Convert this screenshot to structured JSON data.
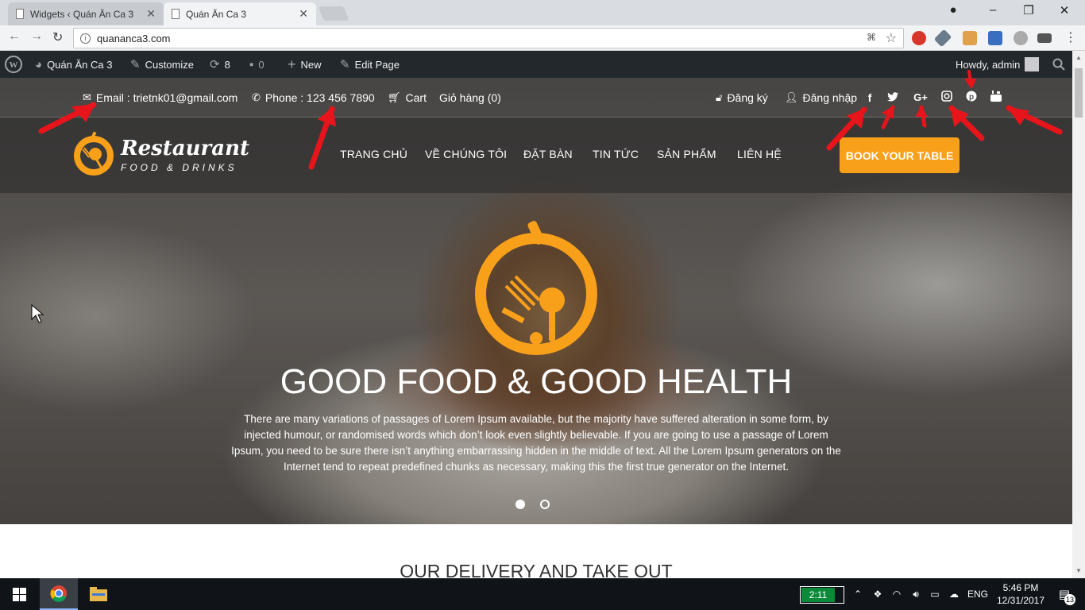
{
  "browser": {
    "tabs": [
      {
        "title": "Widgets ‹ Quán Ăn Ca 3",
        "active": false
      },
      {
        "title": "Quán Ăn Ca 3",
        "active": true
      }
    ],
    "url": "quananca3.com",
    "window_controls": {
      "minimize": "–",
      "maximize": "❐",
      "close": "✕"
    }
  },
  "admin_bar": {
    "site_name": "Quán Ăn Ca 3",
    "customize": "Customize",
    "updates_count": "8",
    "comments_count": "0",
    "new_label": "New",
    "edit_page": "Edit Page",
    "howdy": "Howdy, admin"
  },
  "top_info": {
    "email": "Email : trietnk01@gmail.com",
    "phone": "Phone : 123 456 7890",
    "cart": "Cart",
    "cart_vn": "Giỏ hàng (0)",
    "register": "Đăng ký",
    "login": "Đăng nhập",
    "social_icons": [
      "facebook-icon",
      "twitter-icon",
      "google-plus-icon",
      "instagram-icon",
      "pinterest-icon",
      "youtube-icon"
    ]
  },
  "logo": {
    "title": "Restaurant",
    "subtitle": "FOOD & DRINKS"
  },
  "menu": [
    "TRANG CHỦ",
    "VỀ CHÚNG TÔI",
    "ĐẶT BÀN",
    "TIN TỨC",
    "SẢN PHẨM",
    "LIÊN HỆ"
  ],
  "book_button": "BOOK YOUR TABLE",
  "hero": {
    "title": "GOOD FOOD & GOOD HEALTH",
    "text": "There are many variations of passages of Lorem Ipsum available, but the majority have suffered alteration in some form, by injected humour, or randomised words which don’t look even slightly believable. If you are going to use a passage of Lorem Ipsum, you need to be sure there isn’t anything embarrassing hidden in the middle of text. All the Lorem Ipsum generators on the Internet tend to repeat predefined chunks as necessary, making this the first true generator on the Internet.",
    "slides": 2,
    "active_slide": 1
  },
  "section_title": "OUR DELIVERY AND TAKE OUT",
  "taskbar": {
    "battery_time": "2:11",
    "language": "ENG",
    "time": "5:46 PM",
    "date": "12/31/2017",
    "notifications": "13"
  },
  "colors": {
    "accent": "#f9a01b",
    "admin_bar": "#23282d",
    "taskbar": "#101418",
    "annotation_arrow": "#e8141b"
  }
}
